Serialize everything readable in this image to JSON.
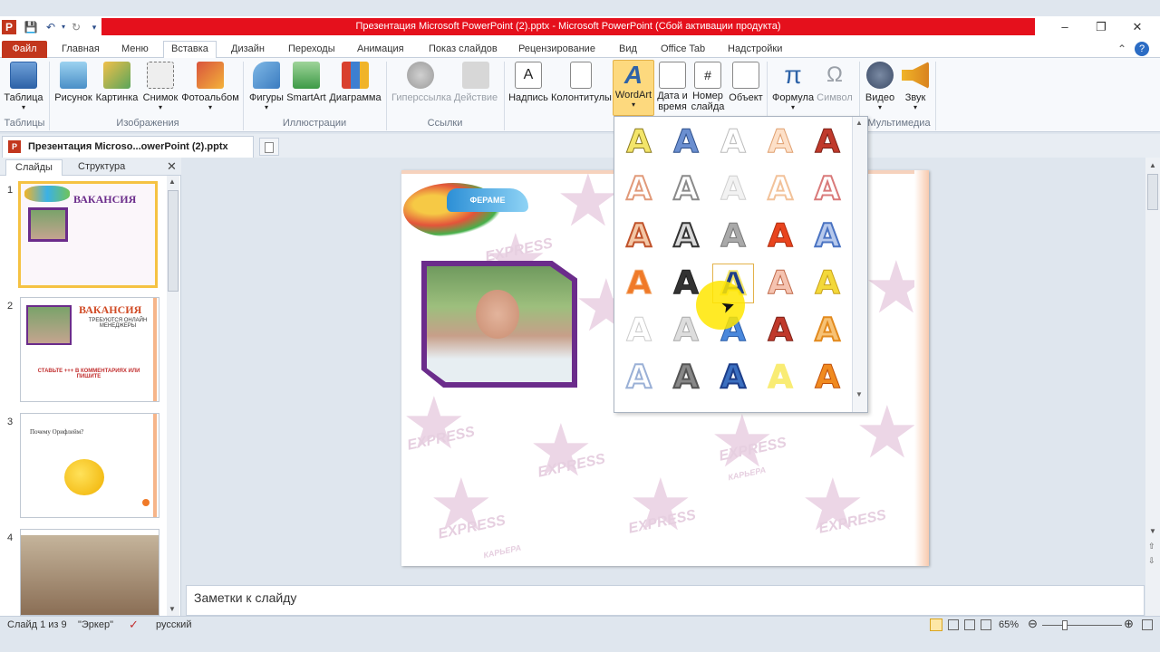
{
  "window": {
    "title": "Презентация Microsoft PowerPoint (2).pptx  -  Microsoft PowerPoint (Сбой активации продукта)"
  },
  "tabs": {
    "file": "Файл",
    "items": [
      "Главная",
      "Меню",
      "Вставка",
      "Дизайн",
      "Переходы",
      "Анимация",
      "Показ слайдов",
      "Рецензирование",
      "Вид",
      "Office Tab",
      "Надстройки"
    ],
    "active": "Вставка"
  },
  "ribbon": {
    "table": "Таблица",
    "picture": "Рисунок",
    "clipart": "Картинка",
    "screenshot": "Снимок",
    "album": "Фотоальбом",
    "shapes": "Фигуры",
    "smartart": "SmartArt",
    "chart": "Диаграмма",
    "hyperlink": "Гиперссылка",
    "action": "Действие",
    "textbox": "Надпись",
    "headerfooter": "Колонтитулы",
    "wordart": "WordArt",
    "datetime_1": "Дата и",
    "datetime_2": "время",
    "slidenum_1": "Номер",
    "slidenum_2": "слайда",
    "object": "Объект",
    "formula": "Формула",
    "symbol": "Символ",
    "video": "Видео",
    "audio": "Звук",
    "groups": {
      "tables": "Таблицы",
      "images": "Изображения",
      "illustrations": "Иллюстрации",
      "links": "Ссылки",
      "multimedia": "Мультимедиа"
    }
  },
  "doc_tab": "Презентация Microso...owerPoint (2).pptx",
  "panel": {
    "tab_slides": "Слайды",
    "tab_outline": "Структура"
  },
  "thumbnails": [
    {
      "num": "1",
      "title": "ВАКАНСИЯ"
    },
    {
      "num": "2",
      "title": "ВАКАНСИЯ",
      "sub": "ТРЕБУЮТСЯ ОНЛАЙН МЕНЕДЖЕРЫ",
      "cta": "СТАВЬТЕ +++ В КОММЕНТАРИЯХ ИЛИ ПИШИТЕ"
    },
    {
      "num": "3",
      "text": "Почему Орифлейм?"
    },
    {
      "num": "4"
    }
  ],
  "slide": {
    "logo": "ФЕРАМЕ",
    "watermark": "EXPRESS",
    "watermark_sub": "КАРЬЕРА"
  },
  "notes": {
    "placeholder": "Заметки к слайду"
  },
  "status": {
    "slide": "Слайд 1 из 9",
    "theme": "\"Эркер\"",
    "lang": "русский",
    "zoom": "65%"
  },
  "colors": {
    "file_tab": "#c2361d",
    "titlebar": "#e5101c",
    "wordart_highlight": "#fdd97e"
  },
  "wordart_gallery": {
    "letter": "A"
  }
}
